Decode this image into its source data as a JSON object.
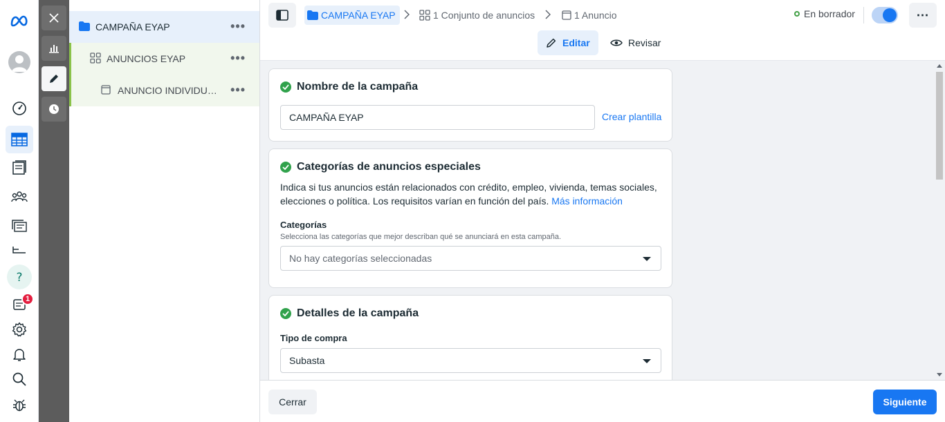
{
  "sidebar": {
    "notifications_badge": "1",
    "icons": [
      "meta-logo-icon",
      "avatar",
      "dashboard-icon",
      "ads-manager-table-icon",
      "catalog-icon",
      "audiences-icon",
      "media-library-icon",
      "billing-icon",
      "help-icon",
      "ad-account-icon",
      "settings-icon",
      "bell-icon",
      "search-icon",
      "bug-icon"
    ]
  },
  "tree": {
    "campaign": "CAMPAÑA EYAP",
    "adset": "ANUNCIOS EYAP",
    "ad": "ANUNCIO INDIVIDUAL..."
  },
  "header": {
    "breadcrumb_campaign": "CAMPAÑA EYAP",
    "breadcrumb_adset": "1 Conjunto de anuncios",
    "breadcrumb_ad": "1 Anuncio",
    "status": "En borrador",
    "tab_edit": "Editar",
    "tab_review": "Revisar"
  },
  "campaign_name": {
    "title": "Nombre de la campaña",
    "value": "CAMPAÑA EYAP",
    "template_link": "Crear plantilla"
  },
  "special_categories": {
    "title": "Categorías de anuncios especiales",
    "description": "Indica si tus anuncios están relacionados con crédito, empleo, vivienda, temas sociales, elecciones o política. Los requisitos varían en función del país.",
    "more_info": "Más información",
    "label": "Categorías",
    "help": "Selecciona las categorías que mejor describan qué se anunciará en esta campaña.",
    "placeholder": "No hay categorías seleccionadas"
  },
  "campaign_details": {
    "title": "Detalles de la campaña",
    "buy_type_label": "Tipo de compra",
    "buy_type_value": "Subasta"
  },
  "footer": {
    "close": "Cerrar",
    "next": "Siguiente"
  },
  "colors": {
    "accent": "#1877f2",
    "success": "#31a24c",
    "draft_dot": "#43a047",
    "badge": "#e41e3f"
  }
}
